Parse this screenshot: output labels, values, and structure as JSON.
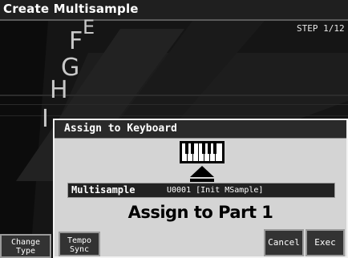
{
  "screen_title": "Create Multisample",
  "step_indicator": "STEP 1/12",
  "background_letters": [
    "E",
    "F",
    "G",
    "H",
    "I"
  ],
  "dialog": {
    "title": "Assign to Keyboard",
    "multisample_label": "Multisample",
    "multisample_value": "U0001 [Init MSample]",
    "assign_text": "Assign to Part 1",
    "tempo_sync_line1": "Tempo",
    "tempo_sync_line2": "Sync",
    "cancel_label": "Cancel",
    "exec_label": "Exec"
  },
  "change_type_line1": "Change",
  "change_type_line2": "Type",
  "icons": [
    "keyboard-icon",
    "up-arrow-icon"
  ]
}
